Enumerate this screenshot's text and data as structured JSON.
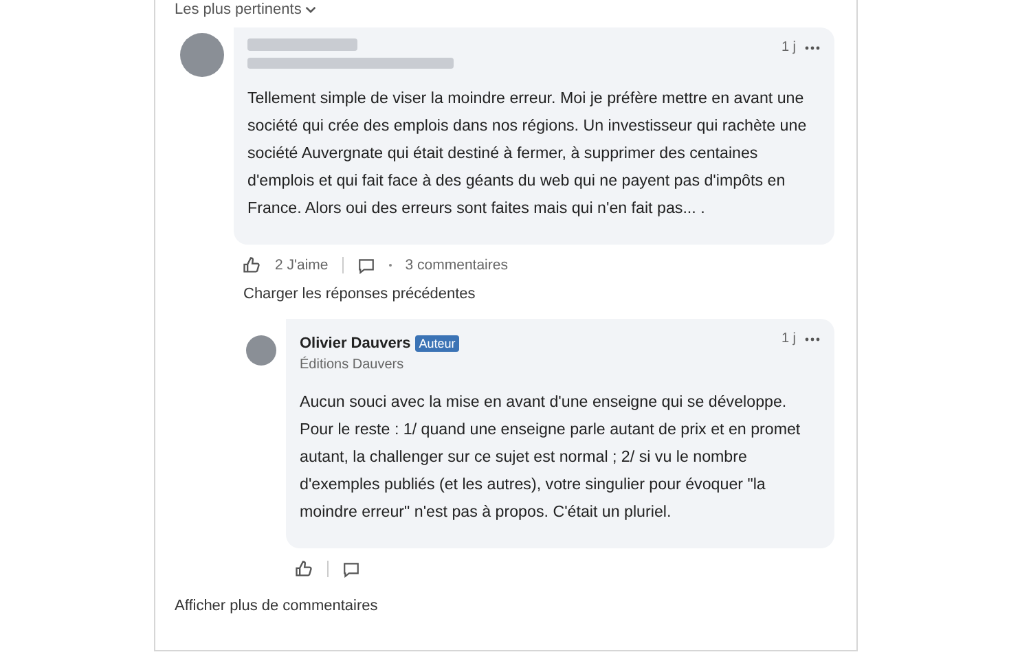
{
  "sort": {
    "label": "Les plus pertinents"
  },
  "comment": {
    "time": "1 j",
    "text": "Tellement simple de viser la moindre erreur. Moi je préfère mettre en avant une société qui crée des emplois dans nos régions. Un investisseur qui rachète une société Auvergnate qui était destiné à fermer, à supprimer des centaines d'emplois et qui fait face à des géants du web qui ne payent pas d'impôts en France. Alors oui des erreurs sont faites mais qui n'en fait pas... .",
    "likes": "2 J'aime",
    "comments": "3 commentaires"
  },
  "load_previous": "Charger les réponses précédentes",
  "reply": {
    "name": "Olivier Dauvers",
    "badge": "Auteur",
    "headline": "Éditions Dauvers",
    "time": "1 j",
    "text": "Aucun souci avec la mise en avant d'une enseigne qui se développe. Pour le reste : 1/ quand une enseigne parle autant de prix et en promet autant, la challenger sur ce sujet est normal ; 2/ si vu le nombre d'exemples publiés (et les autres), votre singulier pour évoquer \"la moindre erreur\" n'est pas à propos. C'était un pluriel."
  },
  "show_more": "Afficher plus de commentaires"
}
